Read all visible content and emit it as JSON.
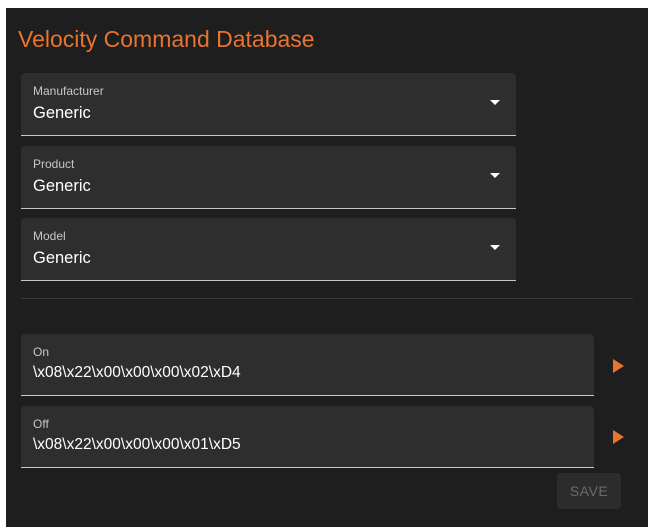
{
  "title": "Velocity Command Database",
  "accent_color": "#e8742f",
  "selects": {
    "manufacturer": {
      "label": "Manufacturer",
      "value": "Generic"
    },
    "product": {
      "label": "Product",
      "value": "Generic"
    },
    "model": {
      "label": "Model",
      "value": "Generic"
    }
  },
  "commands": {
    "on": {
      "label": "On",
      "value": "\\x08\\x22\\x00\\x00\\x00\\x02\\xD4",
      "action_icon": "play-icon"
    },
    "off": {
      "label": "Off",
      "value": "\\x08\\x22\\x00\\x00\\x00\\x01\\xD5",
      "action_icon": "play-icon"
    }
  },
  "save_label": "SAVE",
  "save_enabled": false
}
